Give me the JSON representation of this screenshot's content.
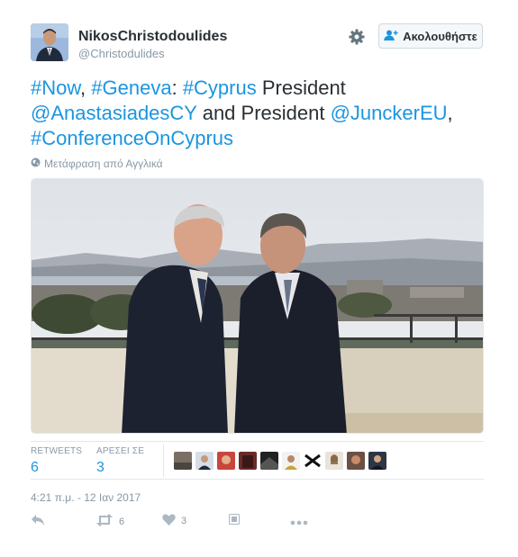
{
  "user": {
    "name": "NikosChristodoulides",
    "handle": "@Christodulides"
  },
  "follow_button": {
    "label": "Ακολουθήστε"
  },
  "tweet": {
    "segments": [
      {
        "text": "#Now",
        "link": true
      },
      {
        "text": ", ",
        "link": false
      },
      {
        "text": "#Geneva",
        "link": true
      },
      {
        "text": ": ",
        "link": false
      },
      {
        "text": "#Cyprus",
        "link": true
      },
      {
        "text": " President ",
        "link": false
      },
      {
        "text": "@AnastasiadesCY",
        "link": true
      },
      {
        "text": " and President ",
        "link": false
      },
      {
        "text": "@JunckerEU",
        "link": true
      },
      {
        "text": ", ",
        "link": false
      },
      {
        "text": "#ConferenceOnCyprus",
        "link": true
      }
    ]
  },
  "translate_label": "Μετάφραση από Αγγλικά",
  "stats": {
    "retweets_label": "RETWEETS",
    "retweets_value": "6",
    "likes_label": "ΑΡΕΣΕΙ ΣΕ",
    "likes_value": "3"
  },
  "timestamp": "4:21 π.μ. - 12 Ιαν 2017",
  "actions": {
    "retweet_count": "6",
    "like_count": "3"
  },
  "icons": [
    "gear-icon",
    "follow-user-icon",
    "globe-icon",
    "reply-icon",
    "retweet-icon",
    "heart-icon",
    "dm-icon",
    "more-icon"
  ],
  "colors": {
    "link": "#1b95e0",
    "text": "#292f33",
    "muted": "#8899a6",
    "border": "#e1e8ed"
  }
}
